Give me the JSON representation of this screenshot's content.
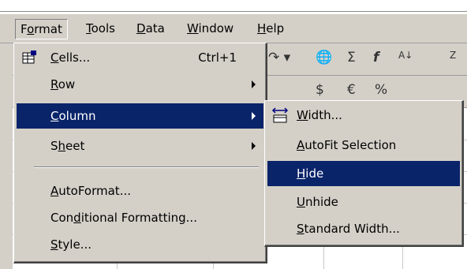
{
  "menubar": {
    "items": [
      {
        "pre": "F",
        "ul": "o",
        "post": "rmat"
      },
      {
        "pre": "",
        "ul": "T",
        "post": "ools"
      },
      {
        "pre": "",
        "ul": "D",
        "post": "ata"
      },
      {
        "pre": "",
        "ul": "W",
        "post": "indow"
      },
      {
        "pre": "",
        "ul": "H",
        "post": "elp"
      }
    ]
  },
  "format_menu": {
    "cells": {
      "pre": "",
      "ul": "C",
      "post": "ells...",
      "accel": "Ctrl+1",
      "icon": "format-cells-icon"
    },
    "row": {
      "pre": "",
      "ul": "R",
      "post": "ow"
    },
    "column": {
      "pre": "",
      "ul": "C",
      "post": "olumn"
    },
    "sheet": {
      "pre": "S",
      "ul": "h",
      "post": "eet"
    },
    "autoformat": {
      "pre": "",
      "ul": "A",
      "post": "utoFormat..."
    },
    "conditional": {
      "pre": "Con",
      "ul": "d",
      "post": "itional Formatting..."
    },
    "style": {
      "pre": "",
      "ul": "S",
      "post": "tyle..."
    }
  },
  "column_submenu": {
    "width": {
      "pre": "",
      "ul": "W",
      "post": "idth...",
      "icon": "column-width-icon"
    },
    "autofit": {
      "pre": "",
      "ul": "A",
      "post": "utoFit Selection"
    },
    "hide": {
      "pre": "",
      "ul": "H",
      "post": "ide"
    },
    "unhide": {
      "pre": "",
      "ul": "U",
      "post": "nhide"
    },
    "standard": {
      "pre": "",
      "ul": "S",
      "post": "tandard Width..."
    }
  },
  "colors": {
    "highlight": "#0a246a",
    "face": "#d4d0c8"
  }
}
